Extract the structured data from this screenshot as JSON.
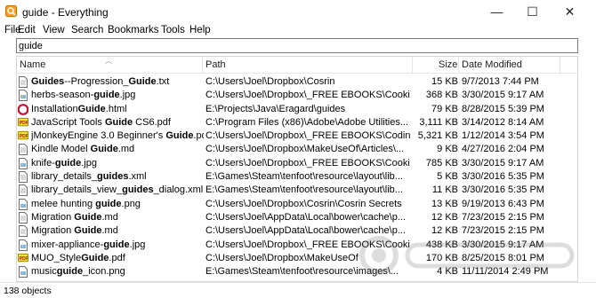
{
  "window": {
    "title": "guide - Everything",
    "minimize_glyph": "—",
    "maximize_glyph": "☐",
    "close_glyph": "✕"
  },
  "menu": [
    "File",
    "Edit",
    "View",
    "Search",
    "Bookmarks",
    "Tools",
    "Help"
  ],
  "search": {
    "value": "guide"
  },
  "columns": {
    "name": "Name",
    "path": "Path",
    "size": "Size",
    "date": "Date Modified"
  },
  "rows": [
    {
      "pre": "",
      "hit1": "Guides",
      "mid": "--Progression_",
      "hit2": "Guide",
      "post": ".txt",
      "path": "C:\\Users\\Joel\\Dropbox\\Cosrin",
      "size": "15 KB",
      "date": "9/7/2013 7:44 PM",
      "icon": "text-file"
    },
    {
      "pre": "herbs-season-",
      "hit1": "guide",
      "mid": ".jpg",
      "hit2": "",
      "post": "",
      "path": "C:\\Users\\Joel\\Dropbox\\_FREE EBOOKS\\Cooki...",
      "size": "368 KB",
      "date": "3/30/2015 9:17 AM",
      "icon": "image-file"
    },
    {
      "pre": "Installation",
      "hit1": "Guide",
      "mid": ".html",
      "hit2": "",
      "post": "",
      "path": "E:\\Projects\\Java\\Eragard\\guides",
      "size": "79 KB",
      "date": "8/28/2015 5:39 PM",
      "icon": "html-file"
    },
    {
      "pre": "JavaScript Tools ",
      "hit1": "Guide",
      "mid": " CS6.pdf",
      "hit2": "",
      "post": "",
      "path": "C:\\Program Files (x86)\\Adobe\\Adobe Utilities...",
      "size": "3,111 KB",
      "date": "3/14/2012 8:14 AM",
      "icon": "pdf-file"
    },
    {
      "pre": "jMonkeyEngine 3.0 Beginner's ",
      "hit1": "Guide",
      "mid": ".pdf",
      "hit2": "",
      "post": "",
      "path": "C:\\Users\\Joel\\Dropbox\\_FREE EBOOKS\\Coding",
      "size": "5,321 KB",
      "date": "1/12/2014 3:54 PM",
      "icon": "pdf-file"
    },
    {
      "pre": "Kindle Model ",
      "hit1": "Guide",
      "mid": ".md",
      "hit2": "",
      "post": "",
      "path": "C:\\Users\\Joel\\Dropbox\\MakeUseOf\\Articles\\...",
      "size": "9 KB",
      "date": "4/27/2016 2:04 PM",
      "icon": "text-file"
    },
    {
      "pre": "knife-",
      "hit1": "guide",
      "mid": ".jpg",
      "hit2": "",
      "post": "",
      "path": "C:\\Users\\Joel\\Dropbox\\_FREE EBOOKS\\Cooki...",
      "size": "785 KB",
      "date": "3/30/2015 9:17 AM",
      "icon": "image-file"
    },
    {
      "pre": "library_details_",
      "hit1": "guides",
      "mid": ".xml",
      "hit2": "",
      "post": "",
      "path": "E:\\Games\\Steam\\tenfoot\\resource\\layout\\lib...",
      "size": "5 KB",
      "date": "3/30/2016 5:35 PM",
      "icon": "text-file"
    },
    {
      "pre": "library_details_view_",
      "hit1": "guides",
      "mid": "_dialog.xml",
      "hit2": "",
      "post": "",
      "path": "E:\\Games\\Steam\\tenfoot\\resource\\layout\\lib...",
      "size": "11 KB",
      "date": "3/30/2016 5:35 PM",
      "icon": "text-file"
    },
    {
      "pre": "melee hunting ",
      "hit1": "guide",
      "mid": ".png",
      "hit2": "",
      "post": "",
      "path": "C:\\Users\\Joel\\Dropbox\\Cosrin\\Cosrin Secrets",
      "size": "13 KB",
      "date": "9/19/2013 6:43 PM",
      "icon": "image-file"
    },
    {
      "pre": "Migration ",
      "hit1": "Guide",
      "mid": ".md",
      "hit2": "",
      "post": "",
      "path": "C:\\Users\\Joel\\AppData\\Local\\bower\\cache\\p...",
      "size": "12 KB",
      "date": "7/23/2015 2:15 PM",
      "icon": "text-file"
    },
    {
      "pre": "Migration ",
      "hit1": "Guide",
      "mid": ".md",
      "hit2": "",
      "post": "",
      "path": "C:\\Users\\Joel\\AppData\\Local\\bower\\cache\\p...",
      "size": "12 KB",
      "date": "7/23/2015 2:15 PM",
      "icon": "text-file"
    },
    {
      "pre": "mixer-appliance-",
      "hit1": "guide",
      "mid": ".jpg",
      "hit2": "",
      "post": "",
      "path": "C:\\Users\\Joel\\Dropbox\\_FREE EBOOKS\\Cooki...",
      "size": "438 KB",
      "date": "3/30/2015 9:17 AM",
      "icon": "image-file"
    },
    {
      "pre": "MUO_Style",
      "hit1": "Guide",
      "mid": ".pdf",
      "hit2": "",
      "post": "",
      "path": "C:\\Users\\Joel\\Dropbox\\MakeUseOf",
      "size": "170 KB",
      "date": "8/25/2015 8:01 PM",
      "icon": "pdf-file"
    },
    {
      "pre": "music",
      "hit1": "guide",
      "mid": "_icon.png",
      "hit2": "",
      "post": "",
      "path": "E:\\Games\\Steam\\tenfoot\\resource\\images\\...",
      "size": "4 KB",
      "date": "11/11/2014 2:49 PM",
      "icon": "image-file"
    }
  ],
  "status": {
    "text": "138 objects"
  }
}
